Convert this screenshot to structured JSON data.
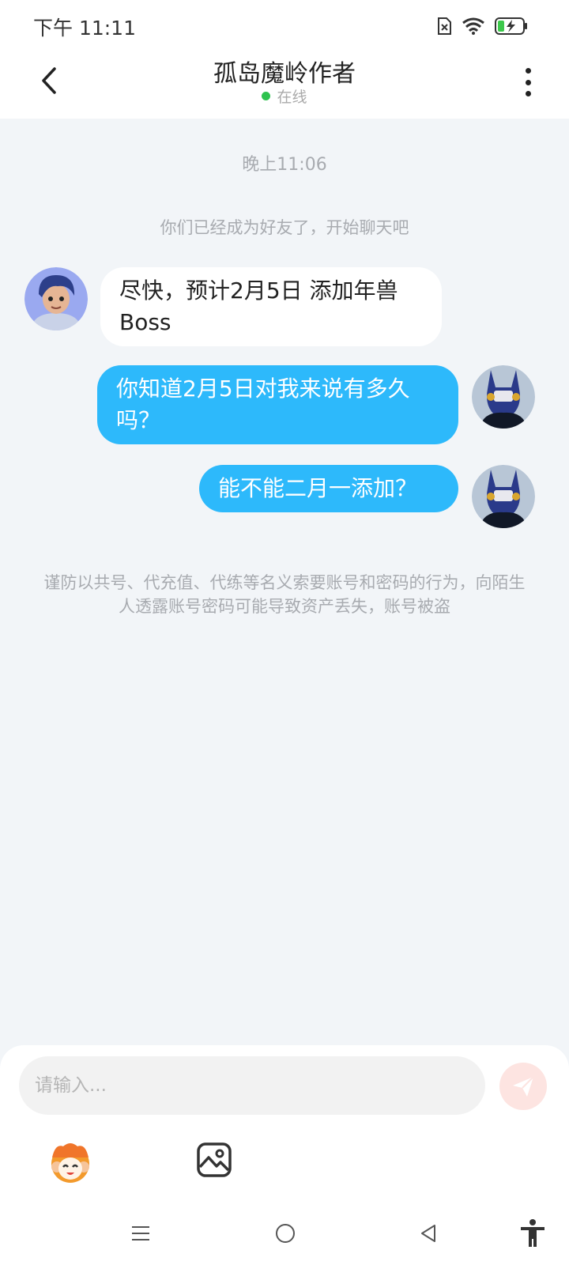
{
  "status_bar": {
    "time": "下午 11:11"
  },
  "header": {
    "title": "孤岛魔岭作者",
    "status": "在线"
  },
  "chat": {
    "timestamp": "晚上11:06",
    "system_note": "你们已经成为好友了，开始聊天吧",
    "messages": [
      {
        "from": "other",
        "text": "尽快，预计2月5日 添加年兽Boss"
      },
      {
        "from": "me",
        "text": "你知道2月5日对我来说有多久吗？"
      },
      {
        "from": "me",
        "text": "能不能二月一添加？"
      }
    ],
    "warning": "谨防以共号、代充值、代练等名义索要账号和密码的行为，向陌生人透露账号密码可能导致资产丢失，账号被盗"
  },
  "input": {
    "placeholder": "请输入..."
  },
  "colors": {
    "accent": "#2db9fb",
    "online": "#2ec24e",
    "send_button": "#fde4e1",
    "background": "#f2f5f8"
  },
  "icons": {
    "back": "chevron-left-icon",
    "more": "more-vertical-icon",
    "send": "paper-plane-icon",
    "emoji": "emoji-sticker-icon",
    "image": "image-icon",
    "nav": [
      "menu-icon",
      "home-icon",
      "back-icon",
      "accessibility-icon"
    ]
  }
}
